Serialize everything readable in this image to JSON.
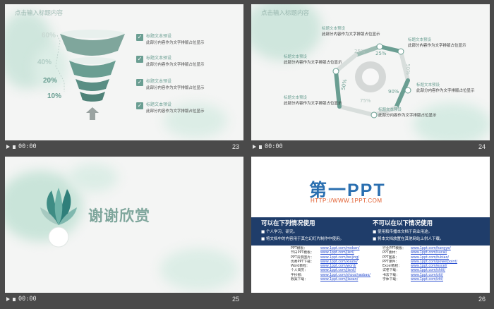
{
  "slides": [
    {
      "number": "23",
      "time": "00:00",
      "title": "点击输入标题内容",
      "percents": [
        "60%",
        "40%",
        "20%",
        "10%"
      ],
      "items": [
        {
          "heading": "标题文本预设",
          "body": "此部分内容作为文字排版占位显示"
        },
        {
          "heading": "标题文本预设",
          "body": "此部分内容作为文字排版占位显示"
        },
        {
          "heading": "标题文本预设",
          "body": "此部分内容作为文字排版占位显示"
        },
        {
          "heading": "标题文本预设",
          "body": "此部分内容作为文字排版占位显示"
        }
      ]
    },
    {
      "number": "24",
      "time": "00:00",
      "title": "点击输入标题内容",
      "ring_values": [
        "25%",
        "50%",
        "90%",
        "75%",
        "50%",
        "25%"
      ],
      "labels": [
        {
          "heading": "标题文本预设",
          "body": "此部分内容作为文字排版占位显示"
        },
        {
          "heading": "标题文本预设",
          "body": "此部分内容作为文字排版占位显示"
        },
        {
          "heading": "标题文本预设",
          "body": "此部分内容作为文字排版占位显示"
        },
        {
          "heading": "标题文本预设",
          "body": "此部分内容作为文字排版占位显示"
        },
        {
          "heading": "标题文本预设",
          "body": "此部分内容作为文字排版占位显示"
        }
      ]
    },
    {
      "number": "25",
      "time": "00:00",
      "thanks": "谢谢欣赏"
    },
    {
      "number": "26",
      "time": "00:00",
      "logo": "第一PPT",
      "url": "HTTP://WWW.1PPT.COM",
      "can_title": "可以在下列情况使用",
      "can_rows": [
        "个人学习、研究。",
        "将文档中的内容用于其它幻灯片制作中使用。"
      ],
      "cannot_title": "不可以在以下情况使用",
      "cannot_rows": [
        "使用和传播本文档于商业用途。",
        "将本文档放置在其他网站上供人下载。"
      ],
      "links_left": [
        [
          "PPT模板：",
          "www.1ppt.com/moban/"
        ],
        [
          "节日PPT模板：",
          "www.1ppt.com/jieri/"
        ],
        [
          "PPT背景图片：",
          "www.1ppt.com/beijing/"
        ],
        [
          "优秀PPT下载：",
          "www.1ppt.com/xiazai/"
        ],
        [
          "Word教程：",
          "www.1ppt.com/word/"
        ],
        [
          "个人简历：",
          "www.1ppt.com/jianli/"
        ],
        [
          "手抄报：",
          "www.1ppt.com/shouchaobao/"
        ],
        [
          "教案下载：",
          "www.1ppt.com/jiaoan/"
        ]
      ],
      "links_right": [
        [
          "行业PPT模板：",
          "www.1ppt.com/hangye/"
        ],
        [
          "PPT素材：",
          "www.1ppt.com/sucai/"
        ],
        [
          "PPT图表：",
          "www.1ppt.com/tubiao/"
        ],
        [
          "PPT课件：",
          "www.1ppt.com/powerpoint/"
        ],
        [
          "Excel教程：",
          "www.1ppt.com/excel/"
        ],
        [
          "试卷下载：",
          "www.1ppt.com/shiti/"
        ],
        [
          "书法下载：",
          "www.1ppt.com/ziti/"
        ],
        [
          "字体下载：",
          "www.1ppt.com/ziti/"
        ]
      ]
    }
  ]
}
